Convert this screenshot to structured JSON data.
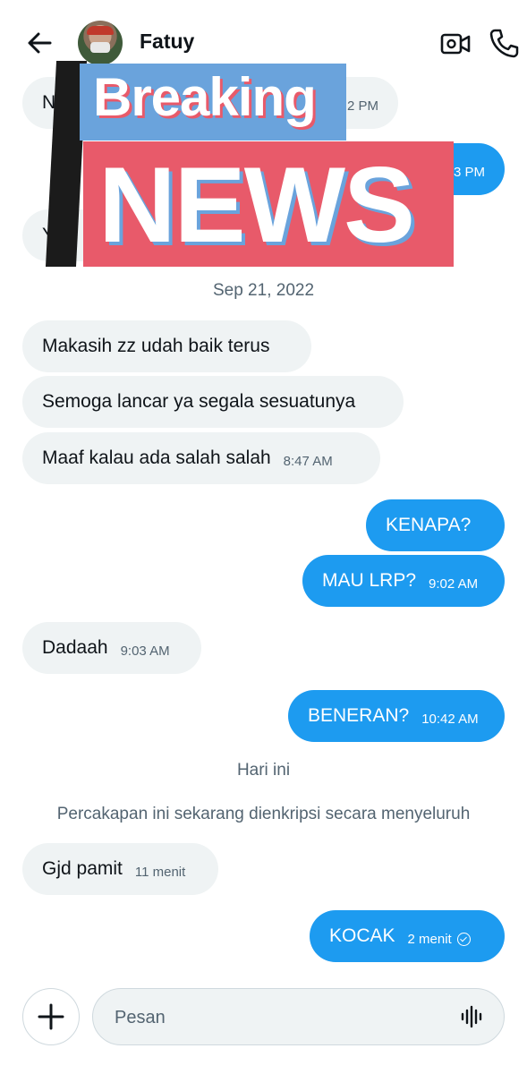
{
  "header": {
    "contact_name": "Fatuy",
    "back_icon": "arrow-left-icon",
    "video_icon": "video-camera-icon",
    "call_icon": "phone-icon"
  },
  "overlay": {
    "line1": "Breaking",
    "line2": "NEWS"
  },
  "messages_top": {
    "m1_text": "N",
    "m1_time": "2 PM",
    "m2_time": "3 PM",
    "m3_text": "Y"
  },
  "date_separator": "Sep 21, 2022",
  "messages": [
    {
      "text": "Makasih zz udah baik terus",
      "time": ""
    },
    {
      "text": "Semoga lancar ya segala sesuatunya",
      "time": ""
    },
    {
      "text": "Maaf kalau ada salah salah",
      "time": "8:47 AM"
    },
    {
      "text": "KENAPA?",
      "time": ""
    },
    {
      "text": "MAU LRP?",
      "time": "9:02 AM"
    },
    {
      "text": "Dadaah",
      "time": "9:03 AM"
    },
    {
      "text": "BENERAN?",
      "time": "10:42 AM"
    },
    {
      "text": "Gjd pamit",
      "time": "11 menit"
    },
    {
      "text": "KOCAK",
      "time": "2 menit"
    }
  ],
  "today_label": "Hari ini",
  "encryption_notice": "Percakapan ini sekarang dienkripsi secara menyeluruh",
  "composer": {
    "placeholder": "Pesan",
    "add_icon": "plus-icon",
    "voice_icon": "voice-waveform-icon"
  },
  "colors": {
    "outgoing_bubble": "#1d9bf0",
    "incoming_bubble": "#eff3f4",
    "overlay_blue": "#6aa3dc",
    "overlay_red": "#e85a6a"
  }
}
